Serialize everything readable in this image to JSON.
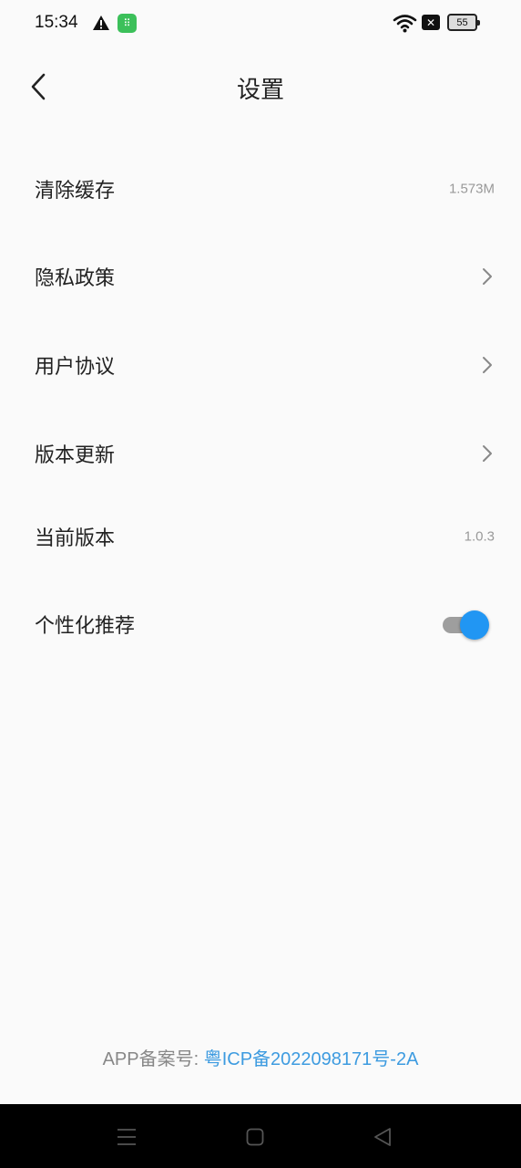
{
  "status_bar": {
    "time": "15:34",
    "battery_level": "55",
    "x_badge": "✕",
    "app_badge": "⠿"
  },
  "header": {
    "title": "设置"
  },
  "settings": {
    "clear_cache": {
      "label": "清除缓存",
      "value": "1.573M"
    },
    "privacy_policy": {
      "label": "隐私政策"
    },
    "user_agreement": {
      "label": "用户协议"
    },
    "version_update": {
      "label": "版本更新"
    },
    "current_version": {
      "label": "当前版本",
      "value": "1.0.3"
    },
    "personalized": {
      "label": "个性化推荐",
      "enabled": true
    }
  },
  "footer": {
    "prefix": "APP备案号: ",
    "icp_number": "粤ICP备2022098171号-2A"
  },
  "colors": {
    "accent": "#2196f3",
    "link": "#3d9be0",
    "background": "#fafafa"
  }
}
